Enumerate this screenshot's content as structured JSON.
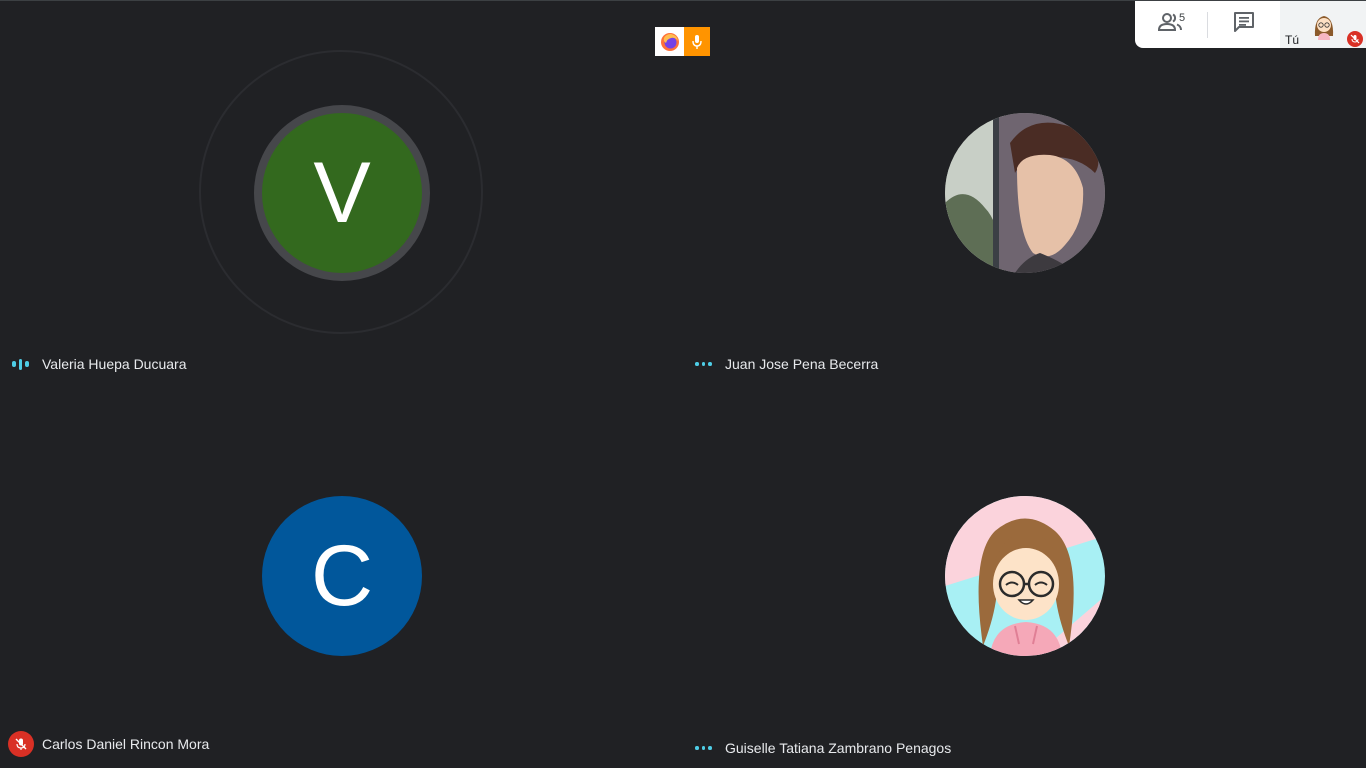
{
  "top_bar": {
    "people_count": "5",
    "people_icon": "people-icon",
    "chat_icon": "chat-icon",
    "self_label": "Tú"
  },
  "share_indicator": {
    "browser_icon": "firefox-icon",
    "mic_icon": "microphone-icon"
  },
  "participants": [
    {
      "name": "Valeria Huepa Ducuara",
      "initial": "V",
      "avatar_color": "#33691e",
      "status": "speaking"
    },
    {
      "name": "Juan Jose Pena Becerra",
      "initial": "",
      "avatar_color": "",
      "status": "connected"
    },
    {
      "name": "Carlos Daniel Rincon Mora",
      "initial": "C",
      "avatar_color": "#01579b",
      "status": "muted"
    },
    {
      "name": "Guiselle Tatiana Zambrano Penagos",
      "initial": "",
      "avatar_color": "",
      "status": "connected"
    }
  ],
  "colors": {
    "background": "#202124",
    "indicator_cyan": "#4ecde6",
    "mute_red": "#d93025",
    "share_orange": "#ff9400"
  }
}
